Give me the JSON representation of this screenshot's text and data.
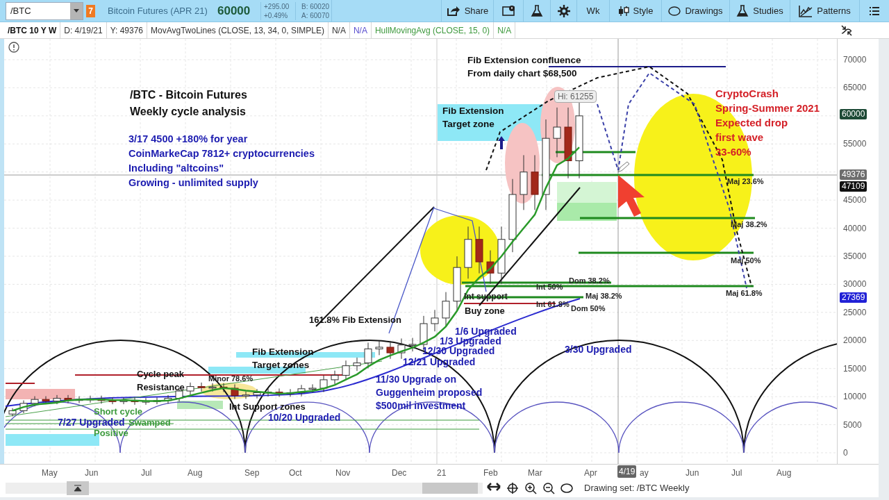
{
  "toolbar": {
    "symbol": "/BTC",
    "badge": "7",
    "description": "Bitcoin Futures (APR 21)",
    "last": "60000",
    "change": "+295.00",
    "change_pct": "+0.49%",
    "bid": "B: 60020",
    "ask": "A: 60070",
    "buttons": [
      {
        "kind": "share",
        "label": "Share"
      },
      {
        "kind": "alert"
      },
      {
        "kind": "flask"
      },
      {
        "kind": "gear"
      },
      {
        "kind": "text",
        "label": "Wk"
      },
      {
        "kind": "style",
        "label": "Style"
      },
      {
        "kind": "ellipse",
        "label": "Drawings"
      },
      {
        "kind": "flask",
        "label": "Studies"
      },
      {
        "kind": "patterns",
        "label": "Patterns"
      },
      {
        "kind": "menu"
      }
    ]
  },
  "info_bar": [
    {
      "text": "/BTC 10 Y W",
      "color": "#111111"
    },
    {
      "text": "D: 4/19/21",
      "color": "#333333"
    },
    {
      "text": "Y: 49376",
      "color": "#333333"
    },
    {
      "text": "MovAvgTwoLines (CLOSE, 13, 34, 0, SIMPLE)",
      "color": "#333333"
    },
    {
      "text": "N/A",
      "color": "#333333"
    },
    {
      "text": "N/A",
      "color": "#5a4fcf"
    },
    {
      "text": "HullMovingAvg (CLOSE, 15, 0)",
      "color": "#3f9a3f"
    },
    {
      "text": "N/A",
      "color": "#3f9a3f"
    }
  ],
  "chart": {
    "y_axis": [
      "70000",
      "65000",
      "55000",
      "45000",
      "40000",
      "35000",
      "30000",
      "25000",
      "20000",
      "15000",
      "10000",
      "5000",
      "0"
    ],
    "x_axis": [
      "May",
      "Jun",
      "Jul",
      "Aug",
      "Sep",
      "Oct",
      "Nov",
      "Dec",
      "21",
      "Feb",
      "Mar",
      "Apr",
      "ay",
      "Jun",
      "Jul",
      "Aug"
    ],
    "cursor_date": "4/19",
    "hi_label": "Hi: 61255",
    "price_tags": [
      {
        "text": "60000",
        "color": "#1d4a36"
      },
      {
        "text": "49376",
        "color": "#6d6d6d"
      },
      {
        "text": "47109",
        "color": "#111111"
      },
      {
        "text": "27369",
        "color": "#2121d6"
      }
    ],
    "annotations": [
      {
        "lines": [
          "/BTC - Bitcoin Futures",
          "Weekly cycle analysis"
        ],
        "color": "#111111"
      },
      {
        "lines": [
          "3/17 4500 +180% for year",
          "CoinMarkeCap 7812+ cryptocurrencies",
          "Including \"altcoins\"",
          "Growing - unlimited supply"
        ],
        "color": "#1c1cb0"
      },
      {
        "lines": [
          "Fib Extension confluence",
          "From daily chart $68,500"
        ],
        "color": "#111111"
      },
      {
        "lines": [
          "Fib Extension",
          "Target zone"
        ],
        "color": "#111111"
      },
      {
        "lines": [
          "CryptoCrash",
          "Spring-Summer 2021",
          "Expected drop",
          "first wave",
          "33-60%"
        ],
        "color": "#d42027"
      },
      {
        "lines": [
          "Maj 23.6%"
        ],
        "color": "#222222"
      },
      {
        "lines": [
          "Maj 38.2%"
        ],
        "color": "#222222"
      },
      {
        "lines": [
          "Maj 50%"
        ],
        "color": "#222222"
      },
      {
        "lines": [
          "Maj 61.8%"
        ],
        "color": "#222222"
      },
      {
        "lines": [
          "Int 50%"
        ],
        "color": "#222222"
      },
      {
        "lines": [
          "Dom 38.2%"
        ],
        "color": "#222222"
      },
      {
        "lines": [
          "Maj 38.2%"
        ],
        "color": "#222222"
      },
      {
        "lines": [
          "Int 61.8%"
        ],
        "color": "#222222"
      },
      {
        "lines": [
          "Dom 50%"
        ],
        "color": "#222222"
      },
      {
        "lines": [
          "Int support"
        ],
        "color": "#222222"
      },
      {
        "lines": [
          "Buy zone"
        ],
        "color": "#111111"
      },
      {
        "lines": [
          "161.8% Fib Extension"
        ],
        "color": "#111111"
      },
      {
        "lines": [
          "1/6 Upgraded"
        ],
        "color": "#1c1cb0"
      },
      {
        "lines": [
          "1/3 Upgraded"
        ],
        "color": "#1c1cb0"
      },
      {
        "lines": [
          "12/30 Upgraded"
        ],
        "color": "#1c1cb0"
      },
      {
        "lines": [
          "12/21 Upgraded"
        ],
        "color": "#1c1cb0"
      },
      {
        "lines": [
          "11/30 Upgrade on",
          "Guggenheim proposed",
          "$500mil investment"
        ],
        "color": "#1c1cb0"
      },
      {
        "lines": [
          "3/30 Upgraded"
        ],
        "color": "#1c1cb0"
      },
      {
        "lines": [
          "10/20 Upgraded"
        ],
        "color": "#1c1cb0"
      },
      {
        "lines": [
          "7/27 Upgraded"
        ],
        "color": "#1c1cb0"
      },
      {
        "lines": [
          "Fib Extension",
          "Target zones"
        ],
        "color": "#111111"
      },
      {
        "lines": [
          "Cycle peak",
          "Resistance"
        ],
        "color": "#111111"
      },
      {
        "lines": [
          "Minor 78.6%"
        ],
        "color": "#222222"
      },
      {
        "lines": [
          "Int Support zones"
        ],
        "color": "#111111"
      },
      {
        "lines": [
          "Short cycle"
        ],
        "color": "#3c9a3c"
      },
      {
        "lines": [
          "Swamped"
        ],
        "color": "#3c9a3c"
      },
      {
        "lines": [
          "Positive"
        ],
        "color": "#3c9a3c"
      }
    ]
  },
  "bottom_bar": {
    "drawing_set": "Drawing set: /BTC Weekly"
  }
}
